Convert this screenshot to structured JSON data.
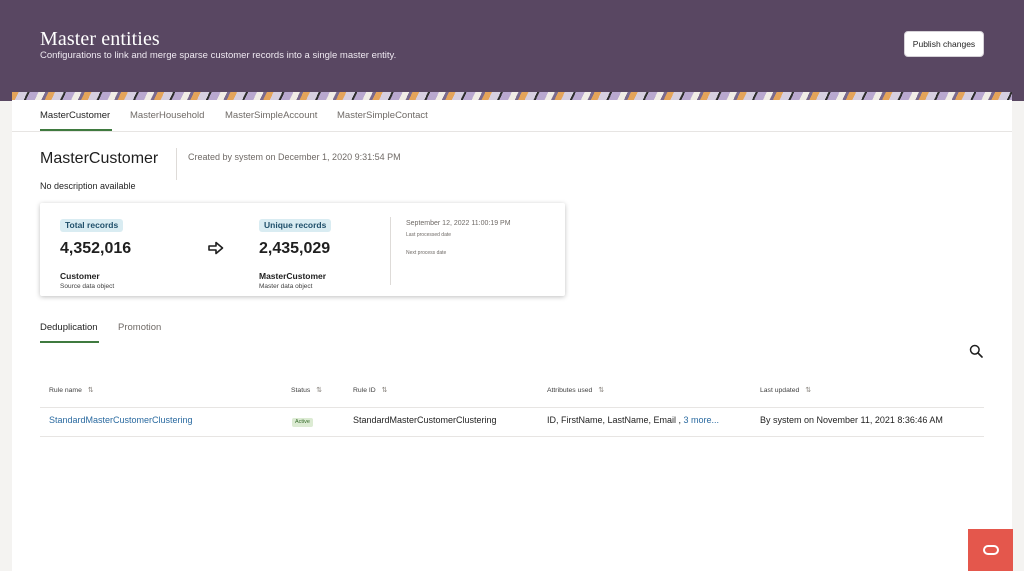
{
  "header": {
    "title": "Master entities",
    "subtitle": "Configurations to link and merge sparse customer records into a single master entity.",
    "publish_label": "Publish changes",
    "background_color": "#594762"
  },
  "tabs": [
    {
      "label": "MasterCustomer",
      "active": true
    },
    {
      "label": "MasterHousehold",
      "active": false
    },
    {
      "label": "MasterSimpleAccount",
      "active": false
    },
    {
      "label": "MasterSimpleContact",
      "active": false
    }
  ],
  "entity": {
    "title": "MasterCustomer",
    "created_by": "Created by system on December 1, 2020 9:31:54 PM",
    "description": "No description available"
  },
  "stats": {
    "total_label": "Total records",
    "total_value": "4,352,016",
    "source_name": "Customer",
    "source_sub": "Source data object",
    "unique_label": "Unique records",
    "unique_value": "2,435,029",
    "master_name": "MasterCustomer",
    "master_sub": "Master data object",
    "last_processed_date": "September 12, 2022 11:00:19 PM",
    "last_processed_label": "Last processed date",
    "next_process_label": "Next process date"
  },
  "subtabs": [
    {
      "label": "Deduplication",
      "active": true
    },
    {
      "label": "Promotion",
      "active": false
    }
  ],
  "table": {
    "headers": [
      "Rule name",
      "Status",
      "Rule ID",
      "Attributes used",
      "Last updated"
    ],
    "rows": [
      {
        "rule_name": "StandardMasterCustomerClustering",
        "status": "Active",
        "rule_id": "StandardMasterCustomerClustering",
        "attributes": "ID, FirstName, LastName, Email ,",
        "attributes_more": "3 more...",
        "last_updated": "By system on November 11, 2021 8:36:46 AM"
      }
    ]
  },
  "icons": {
    "arrow": "arrow-right-icon",
    "search": "search-icon",
    "sort": "sort-icon",
    "fab": "oracle-o-icon"
  },
  "colors": {
    "accent_green": "#3f7a3f",
    "link_blue": "#2a6aa0",
    "fab_red": "#e4574c"
  }
}
